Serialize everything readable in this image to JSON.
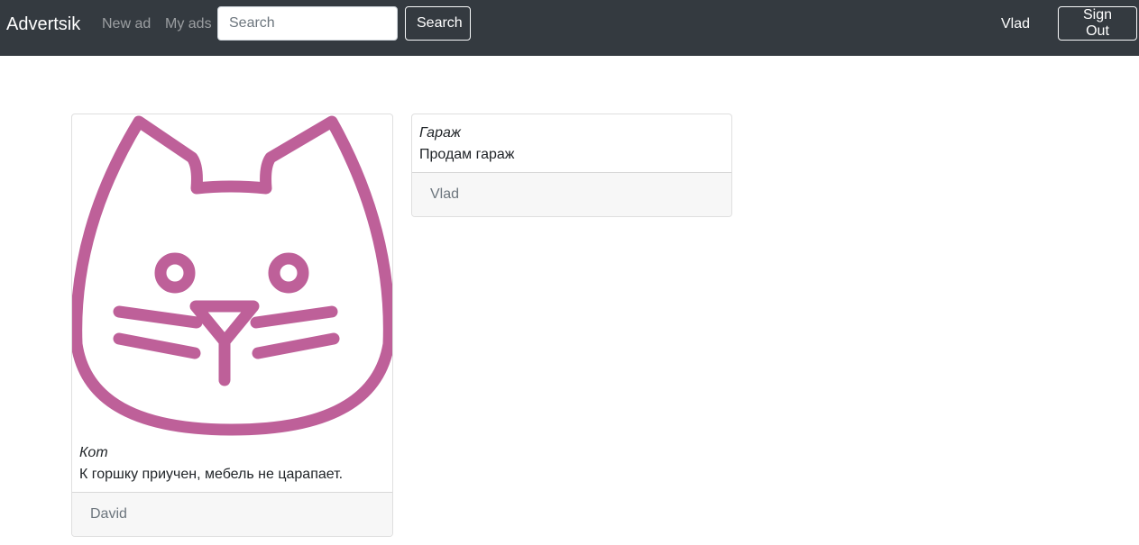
{
  "navbar": {
    "brand": "Advertsik",
    "links": {
      "new_ad": "New ad",
      "my_ads": "My ads"
    },
    "search": {
      "placeholder": "Search",
      "value": "",
      "button": "Search"
    },
    "user": "Vlad",
    "sign_out": "Sign Out"
  },
  "ads": [
    {
      "title": "Кот",
      "text": "К горшку приучен, мебель не царапает.",
      "author": "David",
      "image_icon": "cat-face-icon",
      "image_color": "#be6099"
    },
    {
      "title": "Гараж",
      "text": "Продам гараж",
      "author": "Vlad"
    }
  ],
  "colors": {
    "navbar_bg": "#343a40",
    "footer_bg": "#f7f7f7"
  }
}
